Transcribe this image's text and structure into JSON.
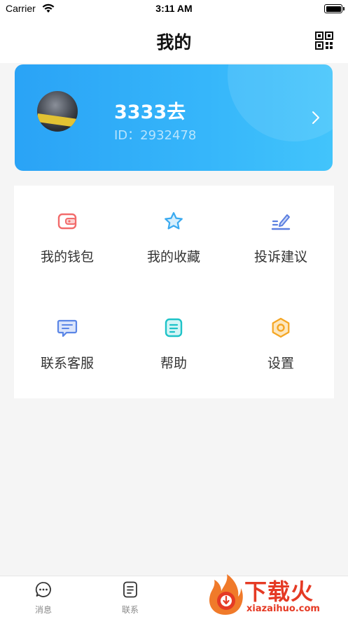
{
  "status_bar": {
    "carrier": "Carrier",
    "time": "3:11 AM"
  },
  "nav": {
    "title": "我的",
    "qr_icon": "qr-code-icon"
  },
  "profile": {
    "username": "3333去",
    "id_label": "ID：",
    "id_value": "2932478"
  },
  "menu": [
    {
      "label": "我的钱包",
      "icon": "wallet-icon",
      "color": "#f26b6b"
    },
    {
      "label": "我的收藏",
      "icon": "star-icon",
      "color": "#3aaaf0"
    },
    {
      "label": "投诉建议",
      "icon": "pen-icon",
      "color": "#5b7fe0"
    },
    {
      "label": "联系客服",
      "icon": "chat-bubble-icon",
      "color": "#5b86e6"
    },
    {
      "label": "帮助",
      "icon": "help-doc-icon",
      "color": "#1ec3c8"
    },
    {
      "label": "设置",
      "icon": "hexagon-settings-icon",
      "color": "#f5a623"
    }
  ],
  "tabbar": [
    {
      "label": "消息",
      "icon": "message-icon"
    },
    {
      "label": "联系",
      "icon": "contacts-icon"
    }
  ],
  "watermark": {
    "brand": "下载火",
    "url": "xiazaihuo.com"
  },
  "colors": {
    "card_start": "#2aa3f6",
    "card_end": "#42c4fb",
    "brand_red": "#e53a24"
  }
}
